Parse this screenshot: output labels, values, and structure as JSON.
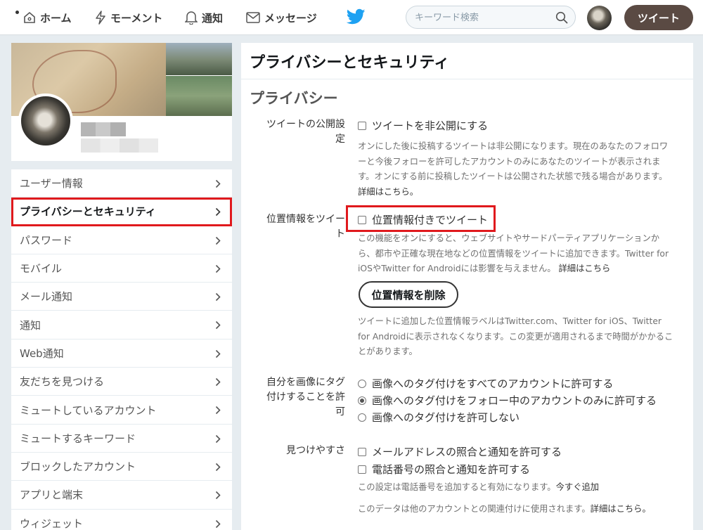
{
  "nav": {
    "home": "ホーム",
    "moments": "モーメント",
    "notifications": "通知",
    "messages": "メッセージ",
    "search_placeholder": "キーワード検索",
    "tweet_button": "ツイート"
  },
  "colors": {
    "accent": "#1da1f2",
    "tweet_button": "#5a4a43",
    "highlight": "#e0191d"
  },
  "sidebar": {
    "items": [
      {
        "label": "ユーザー情報"
      },
      {
        "label": "プライバシーとセキュリティ"
      },
      {
        "label": "パスワード"
      },
      {
        "label": "モバイル"
      },
      {
        "label": "メール通知"
      },
      {
        "label": "通知"
      },
      {
        "label": "Web通知"
      },
      {
        "label": "友だちを見つける"
      },
      {
        "label": "ミュートしているアカウント"
      },
      {
        "label": "ミュートするキーワード"
      },
      {
        "label": "ブロックしたアカウント"
      },
      {
        "label": "アプリと端末"
      },
      {
        "label": "ウィジェット"
      }
    ]
  },
  "main": {
    "title": "プライバシーとセキュリティ",
    "section": "プライバシー",
    "tweet_privacy": {
      "label_line1": "ツイートの公開設",
      "label_line2": "定",
      "option": "ツイートを非公開にする",
      "desc": "オンにした後に投稿するツイートは非公開になります。現在のあなたのフォロワーと今後フォローを許可したアカウントのみにあなたのツイートが表示されます。オンにする前に投稿したツイートは公開された状態で残る場合があります。",
      "link": "詳細はこちら。"
    },
    "location": {
      "label_line1": "位置情報をツイー",
      "label_line2": "ト",
      "option": "位置情報付きでツイート",
      "desc": "この機能をオンにすると、ウェブサイトやサードパーティアプリケーションから、都市や正確な現在地などの位置情報をツイートに追加できます。Twitter for iOSやTwitter for Androidには影響を与えません。",
      "link": "詳細はこちら",
      "delete_button": "位置情報を削除",
      "delete_desc": "ツイートに追加した位置情報ラベルはTwitter.com、Twitter for iOS、Twitter for Androidに表示されなくなります。この変更が適用されるまで時間がかかることがあります。"
    },
    "photo_tagging": {
      "label_line1": "自分を画像にタグ",
      "label_line2": "付けすることを許",
      "label_line3": "可",
      "options": [
        "画像へのタグ付けをすべてのアカウントに許可する",
        "画像へのタグ付けをフォロー中のアカウントのみに許可する",
        "画像へのタグ付けを許可しない"
      ],
      "selected": 1
    },
    "discoverability": {
      "label": "見つけやすさ",
      "option_email": "メールアドレスの照合と通知を許可する",
      "option_phone": "電話番号の照合と通知を許可する",
      "phone_note": "この設定は電話番号を追加すると有効になります。",
      "phone_link": "今すぐ追加",
      "data_note": "このデータは他のアカウントとの関連付けに使用されます。",
      "data_link": "詳細はこちら。"
    }
  }
}
